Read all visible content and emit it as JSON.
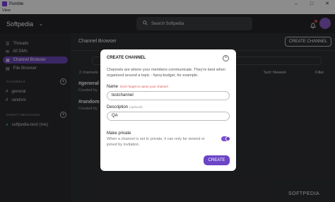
{
  "window": {
    "title": "Pumble",
    "menu": "View"
  },
  "topbar": {
    "workspace": "Softpedia",
    "search_placeholder": "Search Softpedia"
  },
  "sidebar": {
    "items": [
      {
        "label": "Threads"
      },
      {
        "label": "All DMs"
      },
      {
        "label": "Channel Browser"
      },
      {
        "label": "File Browser"
      }
    ],
    "channels_header": "CHANNELS",
    "channels": [
      "general",
      "random"
    ],
    "dm_header": "DIRECT MESSAGES",
    "dms": [
      "softpedia-testi (me)"
    ]
  },
  "main": {
    "title": "Channel Browser",
    "create_button": "CREATE CHANNEL",
    "count": "2 channels",
    "sort": "Sort: Newest",
    "filter": "Filter",
    "rows": [
      {
        "name": "#general",
        "sub": "Created by"
      },
      {
        "name": "#random",
        "sub": "Created by"
      }
    ]
  },
  "modal": {
    "title": "CREATE CHANNEL",
    "description": "Channels are where your members communicate. They're best when organized around a topic - #proj-budget, for example.",
    "name_label": "Name",
    "name_hint": "Don't forget to name your channel",
    "name_value": "testchannel",
    "desc_label": "Description",
    "desc_optional": "(optional)",
    "desc_value": "QA",
    "private_label": "Make private",
    "private_desc": "When a channel is set to private, it can only be viewed or joined by invitation.",
    "private_on": true,
    "create_button": "CREATE",
    "accent": "#6b45c6"
  },
  "watermark": "SOFTPEDIA"
}
